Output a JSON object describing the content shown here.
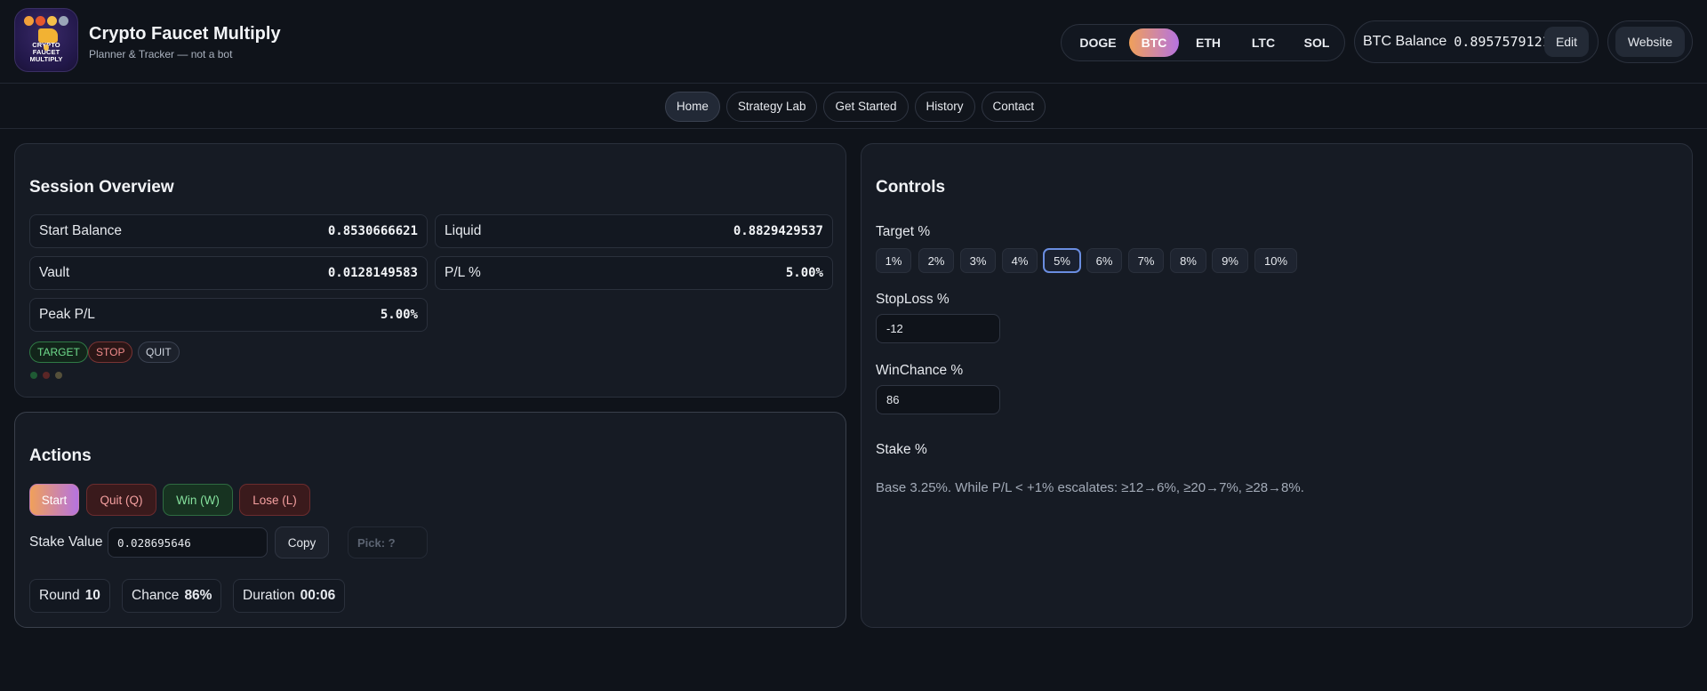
{
  "app": {
    "title": "Crypto Faucet Multiply",
    "subtitle": "Planner & Tracker — not a bot",
    "logo_text": "CRYPTO FAUCET MULTIPLY"
  },
  "coins": [
    {
      "label": "DOGE",
      "active": false
    },
    {
      "label": "BTC",
      "active": true
    },
    {
      "label": "ETH",
      "active": false
    },
    {
      "label": "LTC",
      "active": false
    },
    {
      "label": "SOL",
      "active": false
    }
  ],
  "balance": {
    "label": "BTC Balance",
    "value": "0.8957579121",
    "edit_label": "Edit"
  },
  "website_label": "Website",
  "nav": [
    {
      "label": "Home",
      "active": true
    },
    {
      "label": "Strategy Lab",
      "active": false
    },
    {
      "label": "Get Started",
      "active": false
    },
    {
      "label": "History",
      "active": false
    },
    {
      "label": "Contact",
      "active": false
    }
  ],
  "session": {
    "title": "Session Overview",
    "start_balance": {
      "label": "Start Balance",
      "value": "0.8530666621"
    },
    "liquid": {
      "label": "Liquid",
      "value": "0.8829429537"
    },
    "vault": {
      "label": "Vault",
      "value": "0.0128149583"
    },
    "pl": {
      "label": "P/L %",
      "value": "5.00%"
    },
    "peak_pl": {
      "label": "Peak P/L",
      "value": "5.00%"
    },
    "pills": {
      "target": "TARGET",
      "stop": "STOP",
      "quit": "QUIT"
    },
    "dot_colors": [
      "#1f5a34",
      "#5a2626",
      "#55503a"
    ]
  },
  "actions": {
    "title": "Actions",
    "start": "Start",
    "quit": "Quit (Q)",
    "win": "Win (W)",
    "lose": "Lose (L)",
    "stake_label": "Stake Value",
    "stake_value": "0.028695646",
    "copy": "Copy",
    "pick": "Pick: ?",
    "round_label": "Round",
    "round_value": "10",
    "chance_label": "Chance",
    "chance_value": "86%",
    "duration_label": "Duration",
    "duration_value": "00:06"
  },
  "controls": {
    "title": "Controls",
    "target_label": "Target %",
    "target_options": [
      "1%",
      "2%",
      "3%",
      "4%",
      "5%",
      "6%",
      "7%",
      "8%",
      "9%",
      "10%"
    ],
    "target_selected": "5%",
    "stoploss_label": "StopLoss %",
    "stoploss_value": "-12",
    "winchance_label": "WinChance %",
    "winchance_value": "86",
    "stake_label": "Stake %",
    "stake_note": "Base 3.25%. While P/L < +1% escalates: ≥12→6%, ≥20→7%, ≥28→8%."
  }
}
